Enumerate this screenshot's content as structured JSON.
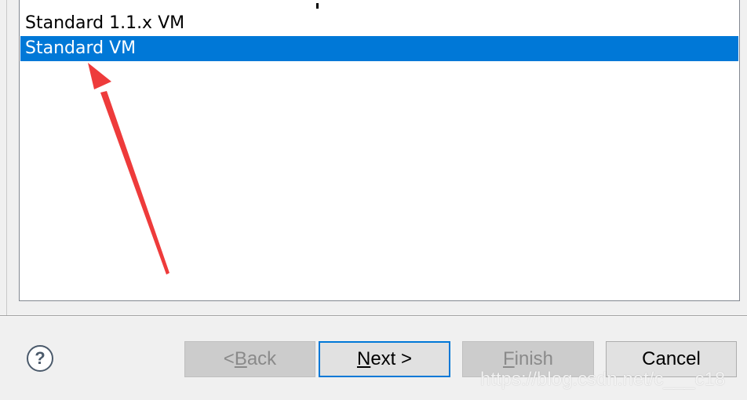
{
  "list": {
    "items": [
      {
        "label": "Standard 1.1.x VM",
        "selected": false
      },
      {
        "label": "Standard VM",
        "selected": true
      }
    ]
  },
  "buttons": {
    "help_symbol": "?",
    "back": {
      "prefix": "< ",
      "mnemonic": "B",
      "rest": "ack"
    },
    "next": {
      "mnemonic": "N",
      "rest": "ext >"
    },
    "finish": {
      "mnemonic": "F",
      "rest": "inish"
    },
    "cancel": "Cancel"
  },
  "watermark": "https://blog.csdn.net/c___c18",
  "colors": {
    "selection": "#0078d7",
    "annotation_arrow": "#ee3b3b"
  }
}
